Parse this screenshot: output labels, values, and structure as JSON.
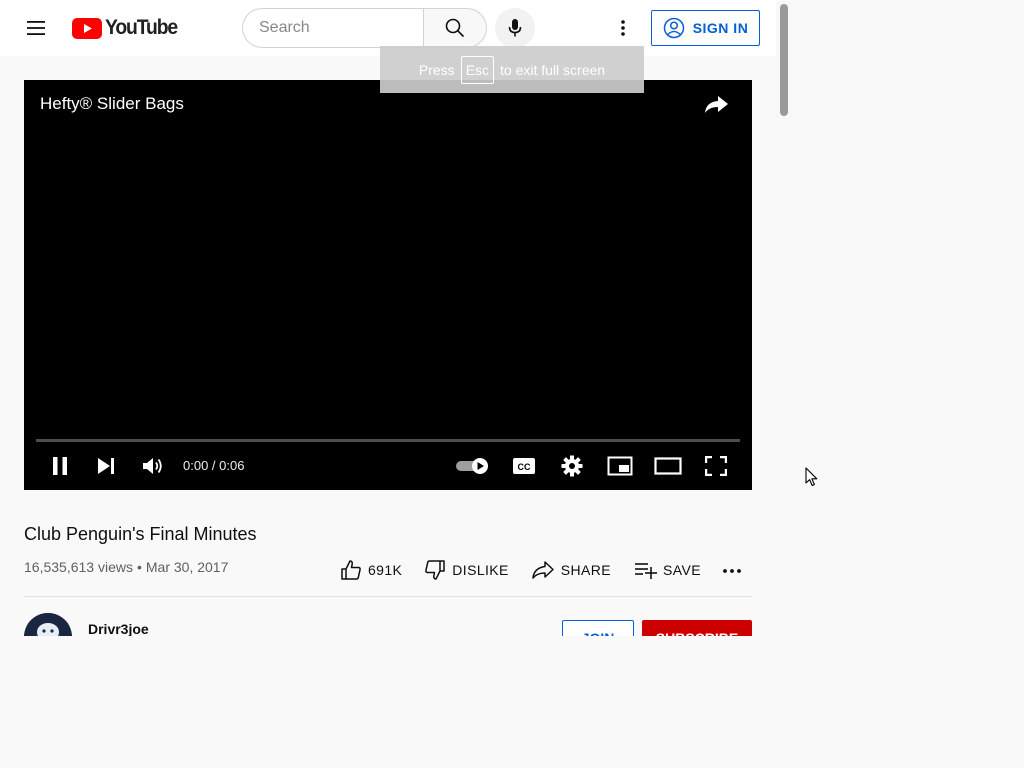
{
  "masthead": {
    "logo_text": "YouTube",
    "search_placeholder": "Search",
    "search_value": "",
    "signin_label": "SIGN IN",
    "icons": {
      "menu": "hamburger-menu-icon",
      "search": "search-icon",
      "mic": "microphone-icon",
      "settings": "vertical-dots-icon",
      "account": "account-circle-icon"
    }
  },
  "fullscreen_hint": {
    "before": "Press",
    "key": "Esc",
    "after": "to exit full screen"
  },
  "player": {
    "title": "Hefty® Slider Bags",
    "time": "0:00 / 0:06",
    "progress_fraction": 0,
    "autoplay": true,
    "controls": [
      "pause-icon",
      "next-icon",
      "volume-icon",
      "autoplay-toggle",
      "captions-icon",
      "settings-gear-icon",
      "miniplayer-icon",
      "theater-mode-icon",
      "fullscreen-icon"
    ]
  },
  "video": {
    "title": "Club Penguin's Final Minutes",
    "views": "16,535,613 views",
    "separator": "•",
    "date": "Mar 30, 2017",
    "actions": {
      "like_count": "691K",
      "dislike_label": "DISLIKE",
      "share_label": "SHARE",
      "save_label": "SAVE"
    }
  },
  "channel": {
    "name": "Drivr3joe",
    "join_label": "JOIN",
    "subscribe_label": "SUBSCRIBE"
  },
  "colors": {
    "brand_red": "#ff0000",
    "subscribe_red": "#cc0000",
    "link_blue": "#065fd4",
    "background": "#f9f9f9"
  }
}
